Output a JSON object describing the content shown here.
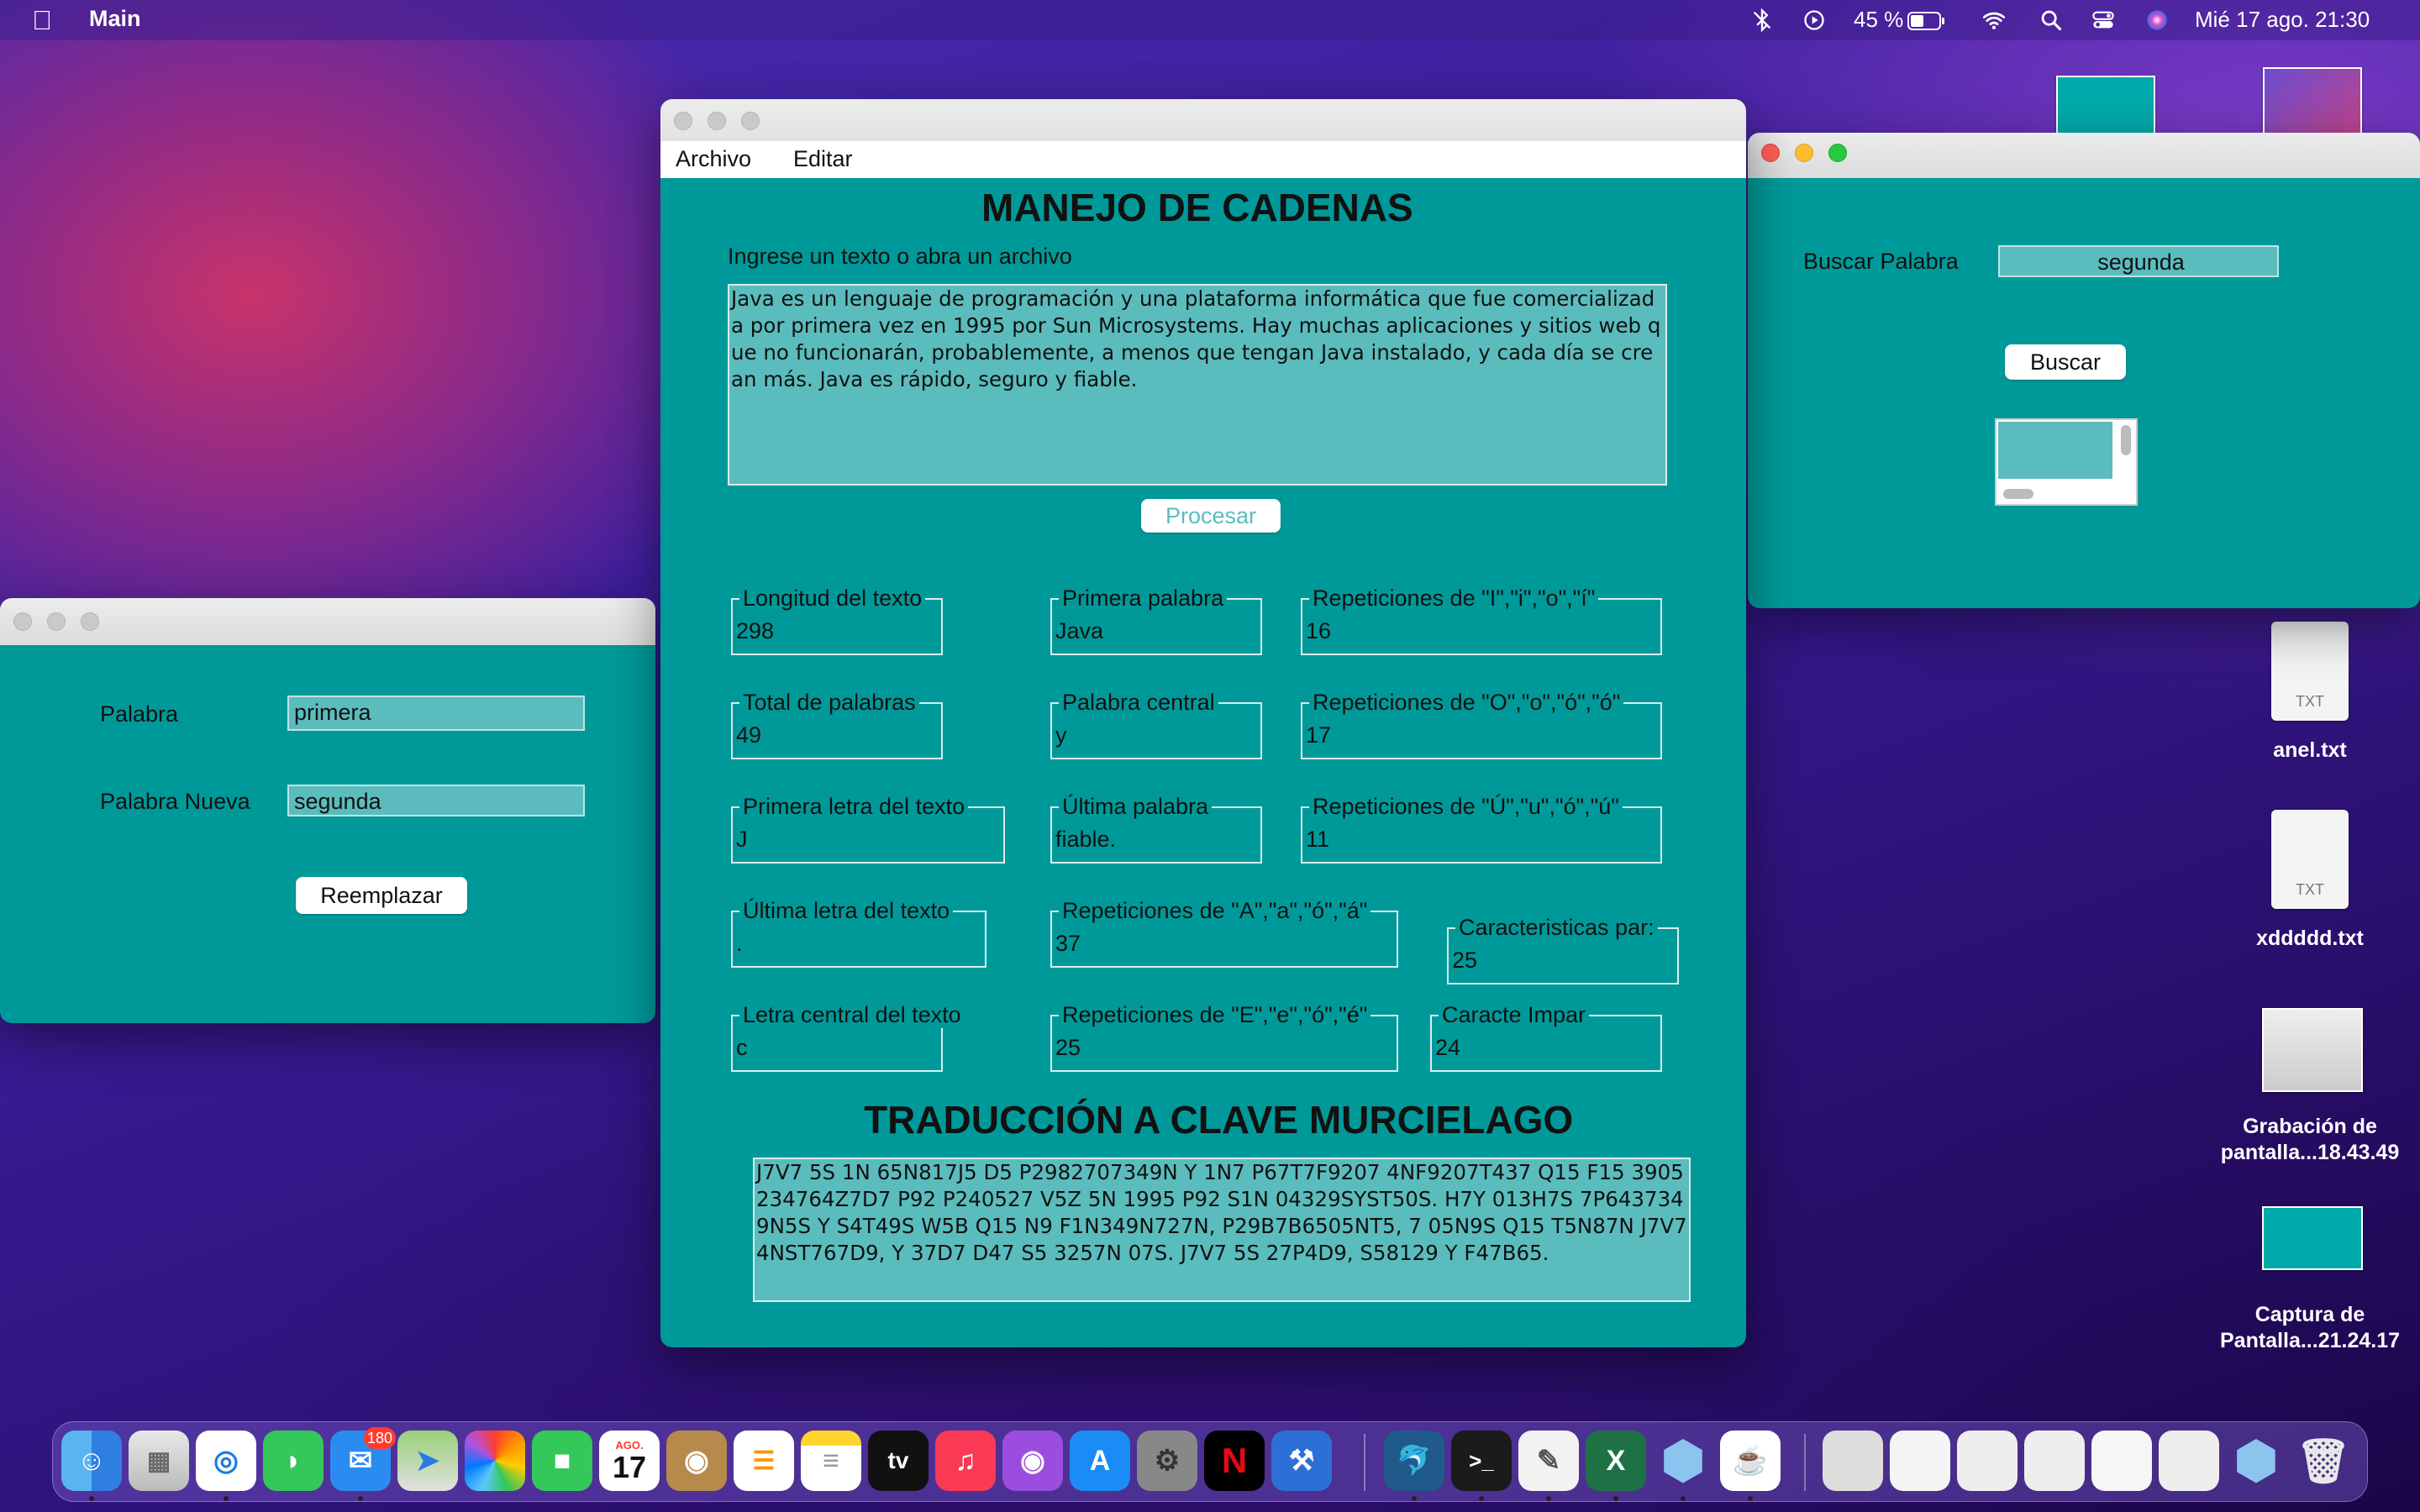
{
  "menubar": {
    "app_name": "Main",
    "battery": "45 %",
    "datetime": "Mié 17 ago.  21:30"
  },
  "main_window": {
    "menu": [
      "Archivo",
      "Editar"
    ],
    "title": "MANEJO DE CADENAS",
    "prompt": "Ingrese un texto o abra un archivo",
    "input_text": "Java es un lenguaje de programación y una plataforma informática que fue comercializada por primera vez en 1995 por Sun Microsystems. Hay muchas aplicaciones y sitios web que no funcionarán, probablemente, a menos que tengan Java instalado, y cada día se crean más. Java es rápido, seguro y fiable.",
    "process_button": "Procesar",
    "stats": [
      {
        "label": "Longitud del texto",
        "value": "298"
      },
      {
        "label": "Primera palabra",
        "value": "Java"
      },
      {
        "label": "Repeticiones de \"I\",\"i\",\"o\",\"í\"",
        "value": "16"
      },
      {
        "label": "Total de palabras",
        "value": "49"
      },
      {
        "label": "Palabra central",
        "value": "y"
      },
      {
        "label": "Repeticiones de \"O\",\"o\",\"ó\",\"ó\"",
        "value": "17"
      },
      {
        "label": "Primera letra del texto",
        "value": "J"
      },
      {
        "label": "Última palabra",
        "value": "fiable."
      },
      {
        "label": "Repeticiones de \"Ú\",\"u\",\"ó\",\"ú\"",
        "value": "11"
      },
      {
        "label": "Última letra del texto",
        "value": "."
      },
      {
        "label": "Repeticiones de \"A\",\"a\",\"ó\",\"á\"",
        "value": "37"
      },
      {
        "label": "Caracteristicas par:",
        "value": "25"
      },
      {
        "label": "Letra central del texto",
        "value": "c"
      },
      {
        "label": "Repeticiones de \"E\",\"e\",\"ó\",\"é\"",
        "value": "25"
      },
      {
        "label": "Caracte Impar",
        "value": "24"
      }
    ],
    "translation_title": "TRADUCCIÓN A CLAVE MURCIELAGO",
    "translation_text": "J7V7 5S 1N 65N817J5 D5 P2982707349N Y 1N7 P67T7F9207 4NF9207T437 Q15 F15 3905234764Z7D7 P92 P240527 V5Z 5N 1995 P92 S1N 04329SYST50S. H7Y 013H7S 7P6437349N5S Y S4T49S W5B Q15 N9 F1N349N727N, P29B7B6505NT5, 7 05N9S Q15 T5N87N J7V7 4NST767D9, Y 37D7 D47 S5 3257N 07S. J7V7 5S 27P4D9, S58129 Y F47B65."
  },
  "replace_window": {
    "word_label": "Palabra",
    "word_value": "primera",
    "new_word_label": "Palabra Nueva",
    "new_word_value": "segunda",
    "button": "Reemplazar"
  },
  "search_window": {
    "label": "Buscar Palabra",
    "value": "segunda",
    "button": "Buscar"
  },
  "desktop_icons": [
    {
      "name": "anel.txt",
      "kind": "TXT"
    },
    {
      "name": "xddddd.txt",
      "kind": "TXT"
    },
    {
      "name": "Grabación de pantalla...18.43.49"
    },
    {
      "name": "Captura de Pantalla...21.24.17"
    }
  ],
  "dock": {
    "mail_badge": "180",
    "calendar_month": "AGO.",
    "calendar_day": "17"
  },
  "colors": {
    "window_bg": "#009999",
    "field_bg": "#5bbcbd"
  }
}
